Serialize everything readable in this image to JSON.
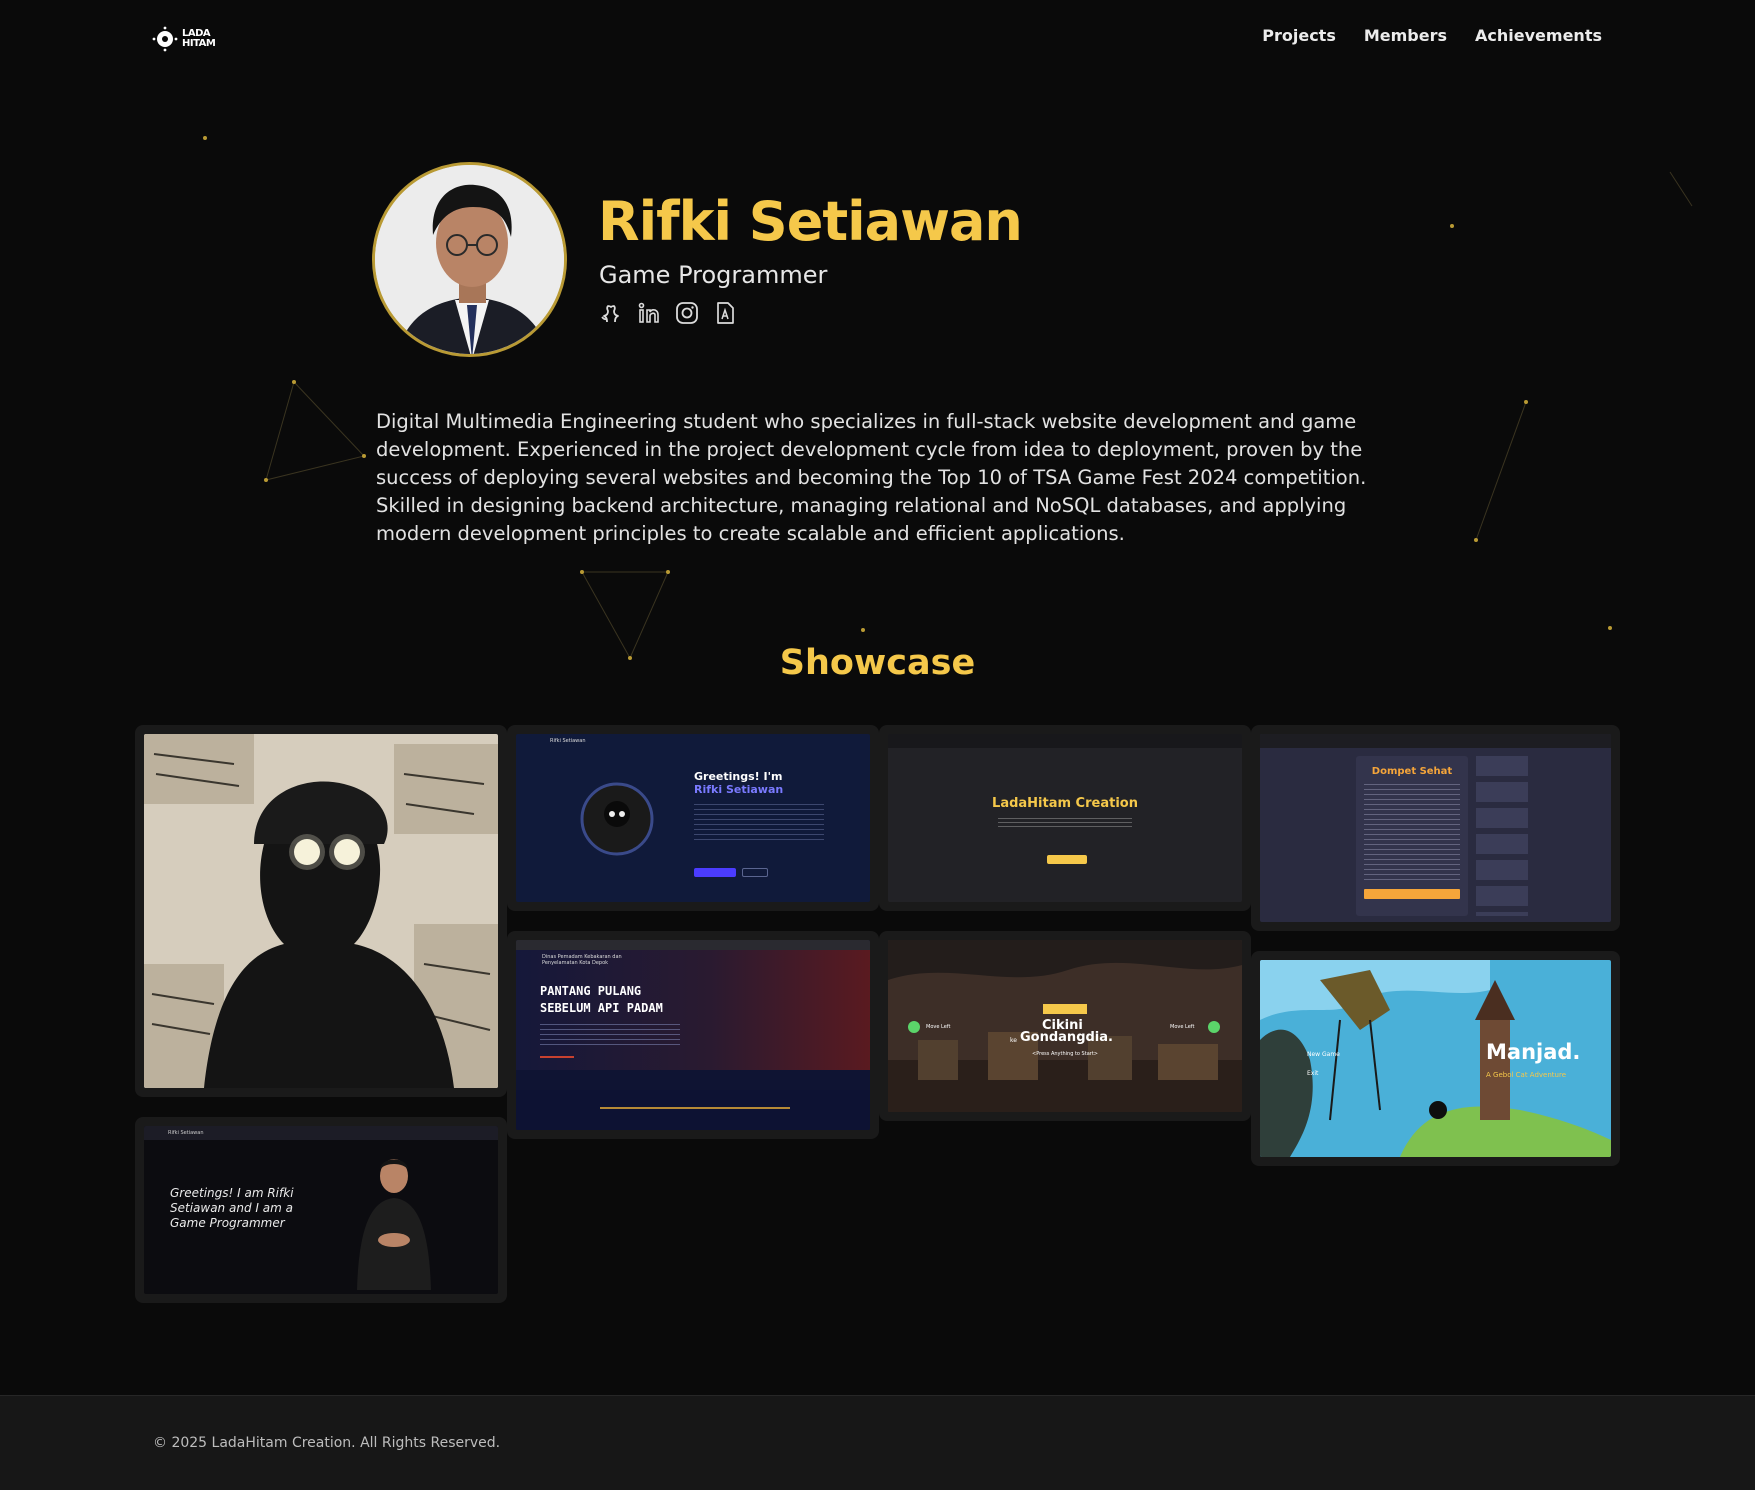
{
  "brand": {
    "logo_line1": "LADA",
    "logo_line2": "HITAM"
  },
  "nav": {
    "items": [
      "Projects",
      "Members",
      "Achievements"
    ]
  },
  "profile": {
    "name": "Rifki Setiawan",
    "role": "Game Programmer",
    "socials": [
      "github-icon",
      "linkedin-icon",
      "instagram-icon",
      "resume-icon"
    ],
    "bio": "Digital Multimedia Engineering student who specializes in full-stack website development and game development. Experienced in the project development cycle from idea to deployment, proven by the success of deploying several websites and becoming the Top 10 of TSA Game Fest 2024 competition. Skilled in designing backend architecture, managing relational and NoSQL databases, and applying modern development principles to create scalable and efficient applications."
  },
  "showcase": {
    "title": "Showcase",
    "items": [
      {
        "name": "collage-artwork"
      },
      {
        "name": "portfolio-dark-site",
        "heading": "Greetings! I'm",
        "highlight": "Rifki Setiawan",
        "brand": "Rifki Setiawan"
      },
      {
        "name": "ladahitam-site",
        "heading": "LadaHitam Creation"
      },
      {
        "name": "dompet-sehat-app",
        "heading": "Dompet Sehat"
      },
      {
        "name": "damkar-depok-site",
        "heading1": "PANTANG PULANG",
        "heading2": "SEBELUM API PADAM",
        "brand": "Dinas Pemadam Kebakaran dan Penyelamatan Kota Depok"
      },
      {
        "name": "cikini-gondangdia-game",
        "line1": "Cikini",
        "line2": "Gondangdia.",
        "prefix": "ke",
        "hint": "<Press Anything to Start>",
        "left": "Move Left",
        "right": "Move Left"
      },
      {
        "name": "manjad-game",
        "title": "Manjad.",
        "subtitle": "A Gebol Cat Adventure",
        "menu1": "New Game",
        "menu2": "Exit"
      },
      {
        "name": "portfolio-light-site",
        "text": "Greetings! I am Rifki Setiawan and I am a Game Programmer",
        "brand": "Rifki Setiawan"
      }
    ]
  },
  "footer": {
    "copyright": "© 2025 LadaHitam Creation. All Rights Reserved."
  },
  "colors": {
    "accent": "#f5c84a",
    "background": "#0a0a0a",
    "footer": "#171717"
  }
}
